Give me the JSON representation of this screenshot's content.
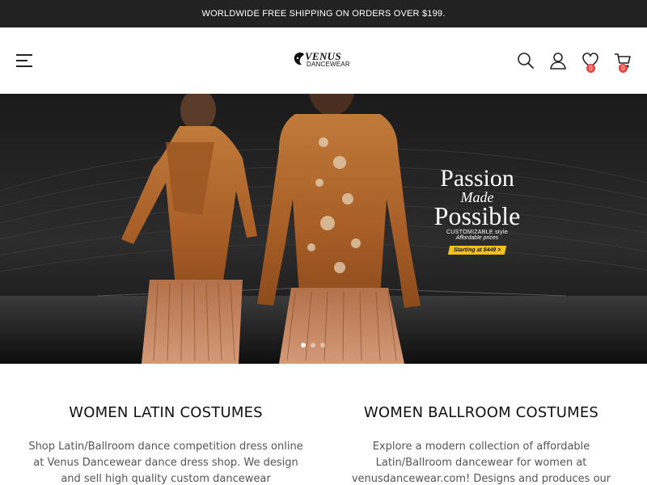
{
  "announcement": "WORLDWIDE FREE SHIPPING ON ORDERS OVER $199.",
  "logo": {
    "line1": "VENUS",
    "line2": "DANCEWEAR"
  },
  "header": {
    "wishlist_count": "0",
    "cart_count": "0"
  },
  "hero": {
    "headline_1": "Passion",
    "headline_2": "Made",
    "headline_3": "Possible",
    "sub_1": "CUSTOMIZABLE style",
    "sub_2": "Affordable prices",
    "price_tag": "Starting at $449 >"
  },
  "categories": [
    {
      "title": "WOMEN LATIN COSTUMES",
      "description": "Shop Latin/Ballroom dance competition dress online at Venus Dancewear dance dress shop. We design and sell high quality custom dancewear"
    },
    {
      "title": "WOMEN BALLROOM COSTUMES",
      "description": "Explore a modern collection of affordable Latin/Ballroom dancewear for women at venusdancewear.com! Designs and produces our"
    }
  ],
  "colors": {
    "topbar": "#222222",
    "badge": "#e8453c",
    "price_tag": "#f4c11c",
    "dress": "#b5651d"
  }
}
